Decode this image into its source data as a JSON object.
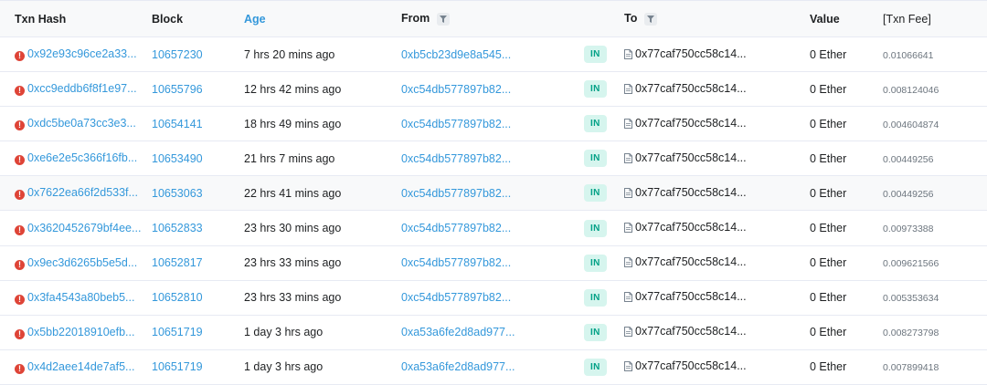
{
  "headers": {
    "hash": "Txn Hash",
    "block": "Block",
    "age": "Age",
    "from": "From",
    "to": "To",
    "value": "Value",
    "fee": "[Txn Fee]"
  },
  "rows": [
    {
      "hash": "0x92e93c96ce2a33...",
      "block": "10657230",
      "age": "7 hrs 20 mins ago",
      "from": "0xb5cb23d9e8a545...",
      "dir": "IN",
      "to": "0x77caf750cc58c14...",
      "value": "0 Ether",
      "fee": "0.01066641"
    },
    {
      "hash": "0xcc9eddb6f8f1e97...",
      "block": "10655796",
      "age": "12 hrs 42 mins ago",
      "from": "0xc54db577897b82...",
      "dir": "IN",
      "to": "0x77caf750cc58c14...",
      "value": "0 Ether",
      "fee": "0.008124046"
    },
    {
      "hash": "0xdc5be0a73cc3e3...",
      "block": "10654141",
      "age": "18 hrs 49 mins ago",
      "from": "0xc54db577897b82...",
      "dir": "IN",
      "to": "0x77caf750cc58c14...",
      "value": "0 Ether",
      "fee": "0.004604874"
    },
    {
      "hash": "0xe6e2e5c366f16fb...",
      "block": "10653490",
      "age": "21 hrs 7 mins ago",
      "from": "0xc54db577897b82...",
      "dir": "IN",
      "to": "0x77caf750cc58c14...",
      "value": "0 Ether",
      "fee": "0.00449256"
    },
    {
      "hash": "0x7622ea66f2d533f...",
      "block": "10653063",
      "age": "22 hrs 41 mins ago",
      "from": "0xc54db577897b82...",
      "dir": "IN",
      "to": "0x77caf750cc58c14...",
      "value": "0 Ether",
      "fee": "0.00449256"
    },
    {
      "hash": "0x3620452679bf4ee...",
      "block": "10652833",
      "age": "23 hrs 30 mins ago",
      "from": "0xc54db577897b82...",
      "dir": "IN",
      "to": "0x77caf750cc58c14...",
      "value": "0 Ether",
      "fee": "0.00973388"
    },
    {
      "hash": "0x9ec3d6265b5e5d...",
      "block": "10652817",
      "age": "23 hrs 33 mins ago",
      "from": "0xc54db577897b82...",
      "dir": "IN",
      "to": "0x77caf750cc58c14...",
      "value": "0 Ether",
      "fee": "0.009621566"
    },
    {
      "hash": "0x3fa4543a80beb5...",
      "block": "10652810",
      "age": "23 hrs 33 mins ago",
      "from": "0xc54db577897b82...",
      "dir": "IN",
      "to": "0x77caf750cc58c14...",
      "value": "0 Ether",
      "fee": "0.005353634"
    },
    {
      "hash": "0x5bb22018910efb...",
      "block": "10651719",
      "age": "1 day 3 hrs ago",
      "from": "0xa53a6fe2d8ad977...",
      "dir": "IN",
      "to": "0x77caf750cc58c14...",
      "value": "0 Ether",
      "fee": "0.008273798"
    },
    {
      "hash": "0x4d2aee14de7af5...",
      "block": "10651719",
      "age": "1 day 3 hrs ago",
      "from": "0xa53a6fe2d8ad977...",
      "dir": "IN",
      "to": "0x77caf750cc58c14...",
      "value": "0 Ether",
      "fee": "0.007899418"
    }
  ],
  "highlighted_row": 4,
  "colors": {
    "link": "#3498db",
    "error": "#de4437",
    "in_badge_bg": "#d6f5ee",
    "in_badge_text": "#00a186"
  },
  "icons": {
    "status": "error-icon",
    "filter": "filter-icon",
    "contract": "document-icon"
  }
}
